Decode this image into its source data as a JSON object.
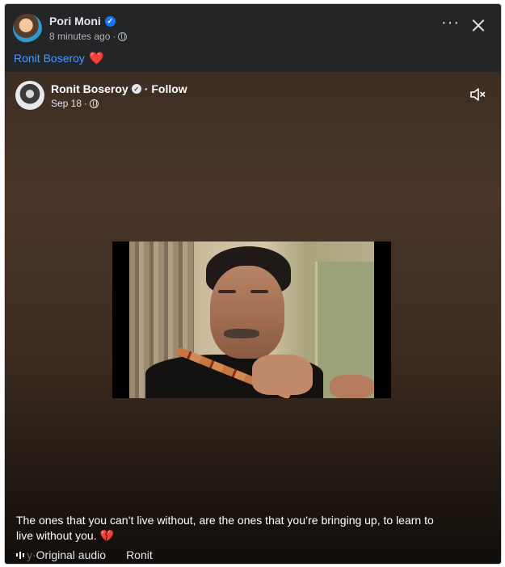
{
  "post": {
    "author": "Pori Moni",
    "time": "8 minutes ago",
    "separator": "·",
    "mention": "Ronit Boseroy",
    "more_icon": "more-options-icon",
    "close_icon": "close-icon"
  },
  "reel": {
    "author": "Ronit Boseroy",
    "follow_label": "Follow",
    "separator": "·",
    "date": "Sep 18",
    "mute_icon": "speaker-muted-icon",
    "caption": "The ones that you can’t live without, are the ones that you’re bringing up, to learn to live without you. ",
    "caption_emoji": "💔",
    "audio_faded": "y",
    "audio_separator": " · ",
    "audio_label": "Original audio",
    "audio_author": "Ronit"
  },
  "colors": {
    "accent_link": "#4599ff",
    "verified": "#1877f2",
    "heart": "#f02849",
    "panel_bg": "#242526"
  }
}
